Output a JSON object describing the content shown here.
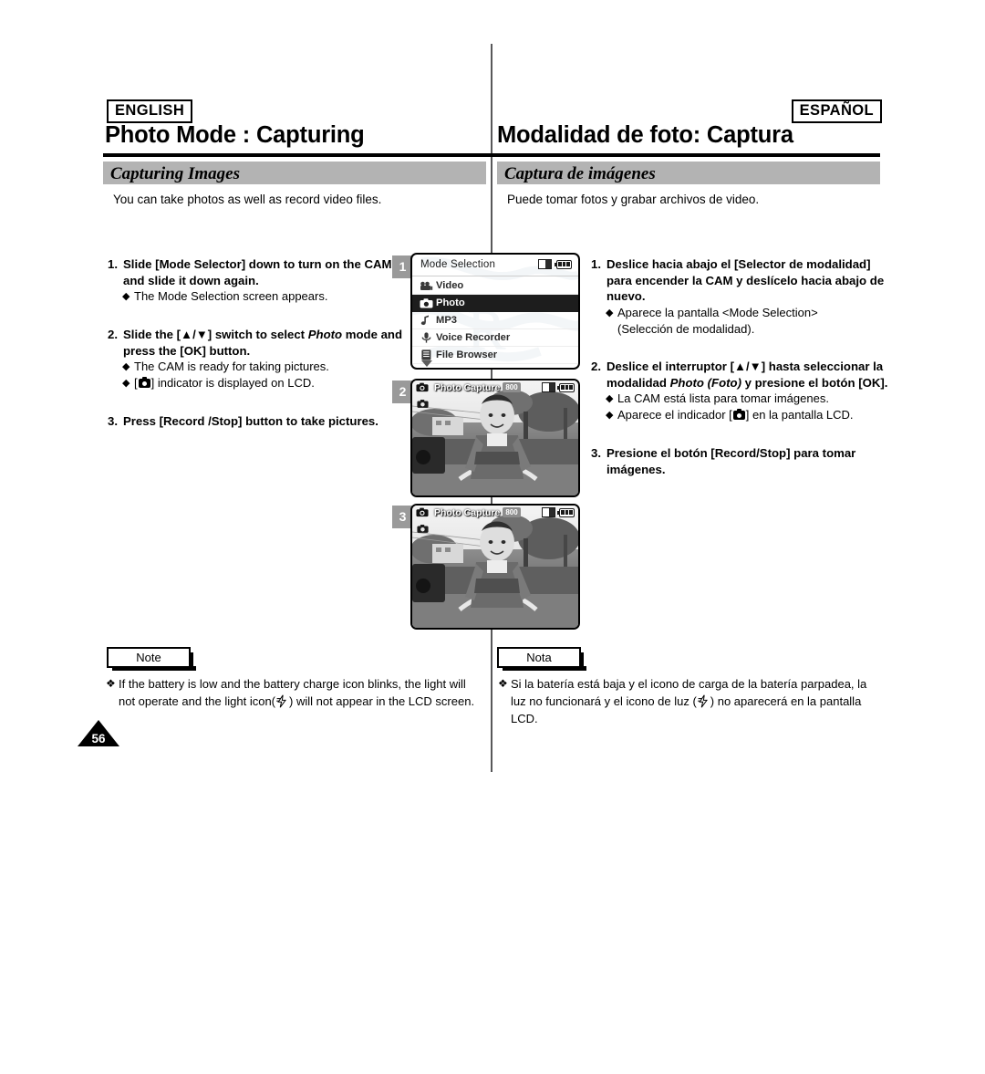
{
  "page": {
    "number": "56",
    "divider": "vertical-rule"
  },
  "columns": {
    "english": {
      "lang_tag": "ENGLISH",
      "title": "Photo Mode : Capturing",
      "section": "Capturing Images",
      "intro": "You can take photos as well as record video files.",
      "steps": [
        {
          "num": "1.",
          "text_before": "Slide [Mode Selector] down to turn on the CAM and slide it down again.",
          "text_italic": "",
          "text_after": "",
          "subs": [
            {
              "mark": "◆",
              "text": "The Mode Selection screen appears."
            }
          ]
        },
        {
          "num": "2.",
          "text_before": "Slide the [▲/▼] switch to select ",
          "text_italic": "Photo",
          "text_after": " mode and press the [OK] button.",
          "subs": [
            {
              "mark": "◆",
              "text": "The CAM is ready for taking pictures."
            },
            {
              "mark": "◆",
              "text_pre": "[",
              "has_cam_icon": true,
              "text_post": "] indicator is displayed on LCD."
            }
          ]
        },
        {
          "num": "3.",
          "text_before": "Press [Record /Stop] button to take pictures.",
          "text_italic": "",
          "text_after": "",
          "subs": []
        }
      ],
      "note": {
        "label": "Note",
        "mark": "❖",
        "text_pre": "If the battery is low and the battery charge icon blinks, the light will not operate and the light icon(",
        "text_post": ") will not appear in the LCD screen."
      }
    },
    "spanish": {
      "lang_tag": "ESPAÑOL",
      "title": "Modalidad de foto: Captura",
      "section": "Captura de imágenes",
      "intro": "Puede tomar fotos y grabar archivos de video.",
      "steps": [
        {
          "num": "1.",
          "text_before": "Deslice hacia abajo el [Selector de modalidad] para encender la CAM y deslícelo hacia abajo de nuevo.",
          "text_italic": "",
          "text_after": "",
          "subs": [
            {
              "mark": "◆",
              "text": "Aparece la pantalla <Mode Selection>"
            }
          ],
          "sub_continuation": "(Selección de modalidad)."
        },
        {
          "num": "2.",
          "text_before": "Deslice el interruptor [▲/▼] hasta seleccionar la modalidad ",
          "text_italic": "Photo (Foto)",
          "text_after": "  y presione el botón [OK].",
          "subs": [
            {
              "mark": "◆",
              "text": "La CAM está lista para tomar imágenes."
            },
            {
              "mark": "◆",
              "text_pre": "Aparece el indicador [",
              "has_cam_icon": true,
              "text_post": "] en la pantalla LCD."
            }
          ]
        },
        {
          "num": "3.",
          "text_before": "Presione el botón [Record/Stop] para tomar imágenes.",
          "text_italic": "",
          "text_after": "",
          "subs": []
        }
      ],
      "note": {
        "label": "Nota",
        "mark": "❖",
        "text_pre": "Si la batería está baja y el icono de carga de la batería parpadea, la luz no funcionará y el icono de luz (",
        "text_post": ") no aparecerá en la pantalla LCD."
      }
    }
  },
  "illustrations": {
    "step1": {
      "badge": "1",
      "screen_title": "Mode Selection",
      "menu": [
        {
          "label": "Video",
          "icon": "video-camera-icon",
          "selected": false
        },
        {
          "label": "Photo",
          "icon": "camera-icon",
          "selected": true
        },
        {
          "label": "MP3",
          "icon": "music-note-icon",
          "selected": false
        },
        {
          "label": "Voice Recorder",
          "icon": "microphone-icon",
          "selected": false
        },
        {
          "label": "File Browser",
          "icon": "file-icon",
          "selected": false
        }
      ],
      "status_icons": [
        "memory-card-icon",
        "battery-icon"
      ],
      "scroll_hint": "chevron-down-icon"
    },
    "step2": {
      "badge": "2",
      "osd_label": "Photo Capture",
      "resolution": "800",
      "status_icons": [
        "camera-mode-icon",
        "memory-card-icon",
        "battery-icon"
      ]
    },
    "step3": {
      "badge": "3",
      "osd_label": "Photo Capture",
      "resolution": "800",
      "status_icons": [
        "camera-mode-icon",
        "memory-card-icon",
        "battery-icon"
      ]
    }
  },
  "colors": {
    "section_bar": "#b3b3b3",
    "badge": "#9a9a9a",
    "selected_row": "#1d1d1d",
    "rule": "#000000"
  }
}
